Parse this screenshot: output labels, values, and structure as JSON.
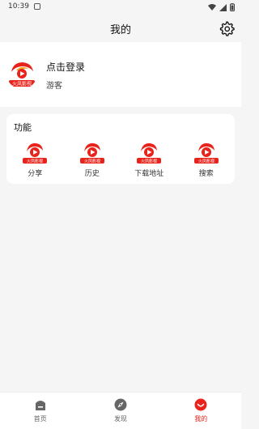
{
  "status": {
    "time": "10:39"
  },
  "header": {
    "title": "我的"
  },
  "profile": {
    "login_label": "点击登录",
    "guest_label": "游客",
    "avatar_text": "火凤影视"
  },
  "features": {
    "title": "功能",
    "icon_text": "火凤影视",
    "items": [
      {
        "label": "分享",
        "icon": "app-logo-icon"
      },
      {
        "label": "历史",
        "icon": "app-logo-icon"
      },
      {
        "label": "下载地址",
        "icon": "app-logo-icon"
      },
      {
        "label": "搜索",
        "icon": "app-logo-icon"
      }
    ]
  },
  "nav": {
    "items": [
      {
        "label": "首页",
        "icon": "home-icon",
        "active": false
      },
      {
        "label": "发现",
        "icon": "discover-icon",
        "active": false
      },
      {
        "label": "我的",
        "icon": "profile-icon",
        "active": true
      }
    ]
  },
  "colors": {
    "accent": "#e8231b",
    "background": "#f5f5f5",
    "card": "#ffffff"
  }
}
